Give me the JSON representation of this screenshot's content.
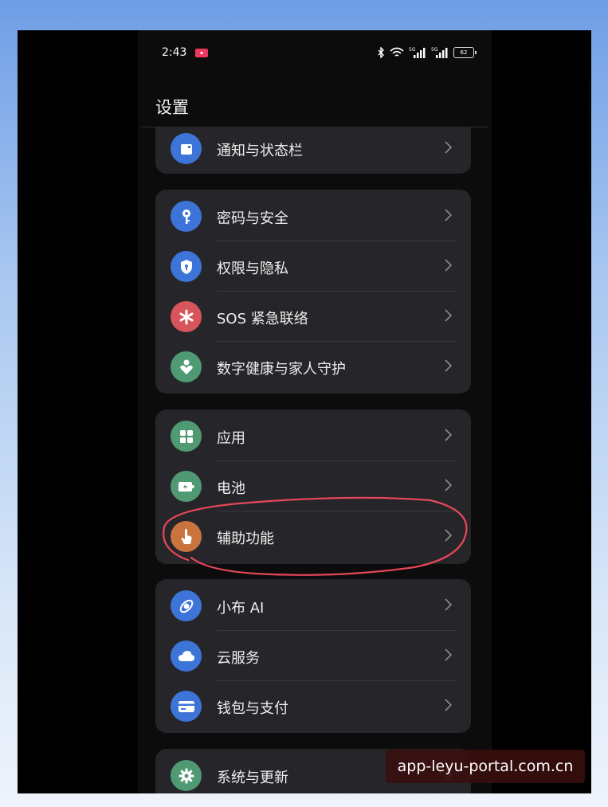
{
  "status_bar": {
    "time": "2:43",
    "battery": "62",
    "signal_1": "5G",
    "signal_2": "5G"
  },
  "header": {
    "title": "设置"
  },
  "groups": [
    {
      "items": [
        {
          "label": "通知与状态栏",
          "icon": "notification-icon",
          "color": "#3d74d8"
        }
      ]
    },
    {
      "items": [
        {
          "label": "密码与安全",
          "icon": "key-icon",
          "color": "#3d74d8"
        },
        {
          "label": "权限与隐私",
          "icon": "shield-icon",
          "color": "#3d74d8"
        },
        {
          "label": "SOS 紧急联络",
          "icon": "asterisk-icon",
          "color": "#d8555c"
        },
        {
          "label": "数字健康与家人守护",
          "icon": "heart-person-icon",
          "color": "#4f9a72"
        }
      ]
    },
    {
      "items": [
        {
          "label": "应用",
          "icon": "apps-grid-icon",
          "color": "#4f9a72"
        },
        {
          "label": "电池",
          "icon": "battery-icon",
          "color": "#4f9a72"
        },
        {
          "label": "辅助功能",
          "icon": "hand-pointer-icon",
          "color": "#c9743f"
        }
      ]
    },
    {
      "items": [
        {
          "label": "小布 AI",
          "icon": "assistant-orbit-icon",
          "color": "#3d74d8"
        },
        {
          "label": "云服务",
          "icon": "cloud-icon",
          "color": "#3d74d8"
        },
        {
          "label": "钱包与支付",
          "icon": "wallet-card-icon",
          "color": "#3d74d8"
        }
      ]
    },
    {
      "items": [
        {
          "label": "系统与更新",
          "icon": "gear-icon",
          "color": "#4f9a72"
        }
      ]
    }
  ],
  "annotation_color": "#e8465a",
  "watermark": "app-leyu-portal.com.cn"
}
